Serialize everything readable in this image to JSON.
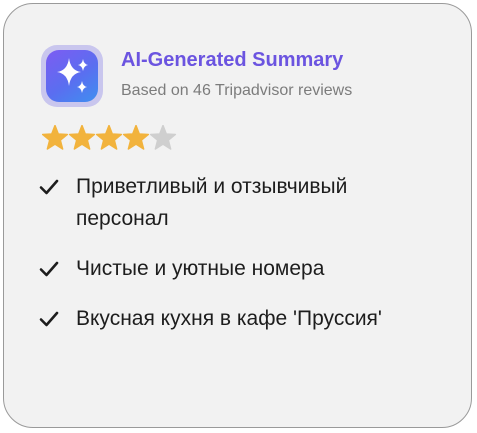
{
  "summary": {
    "icon": "sparkles-icon",
    "title": "AI-Generated Summary",
    "subtitle": "Based on 46 Tripadvisor reviews",
    "rating": {
      "value": 4,
      "max": 5
    },
    "colors": {
      "title": "#6b54e0",
      "star_filled": "#f2b33d",
      "star_empty": "#cfcfcf",
      "icon_gradient_start": "#7d5cf2",
      "icon_gradient_end": "#3f8ff0"
    },
    "points": [
      {
        "icon": "checkmark-icon",
        "text": "Приветливый и отзывчивый персонал"
      },
      {
        "icon": "checkmark-icon",
        "text": "Чистые и уютные номера"
      },
      {
        "icon": "checkmark-icon",
        "text": "Вкусная кухня в кафе 'Пруссия'"
      }
    ]
  }
}
